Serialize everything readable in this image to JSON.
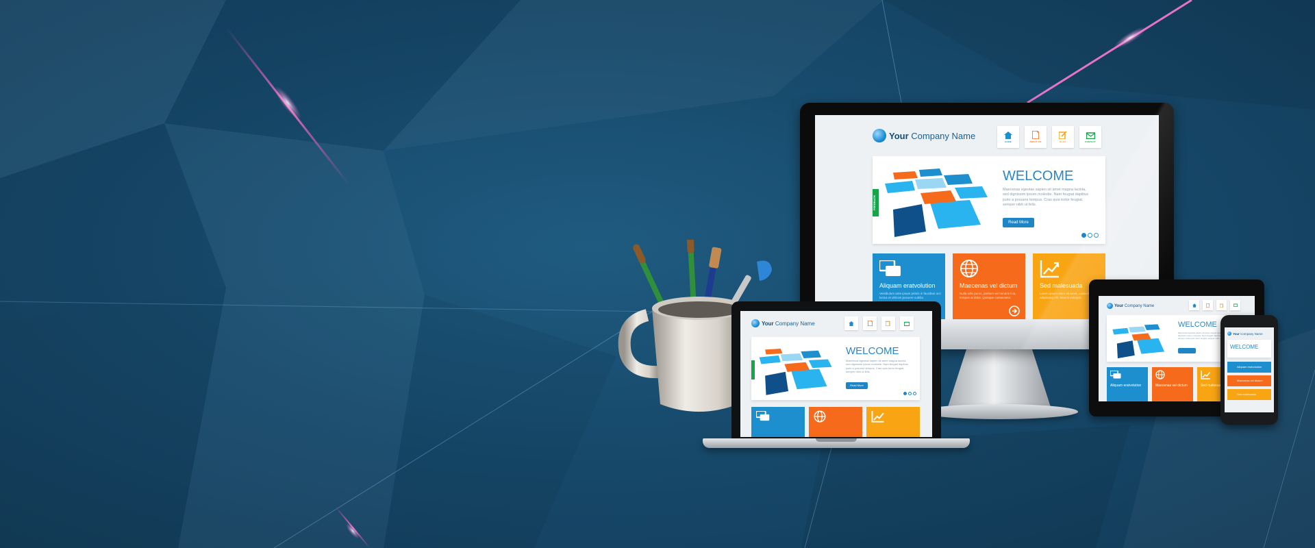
{
  "colors": {
    "background": "#174a6c",
    "accent_blue": "#1d8fcf",
    "accent_orange": "#f66b1b",
    "accent_amber": "#f9a413",
    "feedback_green": "#16a44a"
  },
  "mockup": {
    "company_bold": "Your",
    "company_rest": " Company Name",
    "nav": [
      {
        "label": "HOME",
        "icon": "home-icon",
        "color": "#1d8fcf"
      },
      {
        "label": "ABOUT US",
        "icon": "document-icon",
        "color": "#f66b1b"
      },
      {
        "label": "BLOG",
        "icon": "edit-icon",
        "color": "#f9a413"
      },
      {
        "label": "CONTACT",
        "icon": "mail-icon",
        "color": "#16a44a"
      }
    ],
    "hero_title": "WELCOME",
    "hero_text": "Maecenas egestas sapien sit amet magna lacinia, sed dignissim ipsum molestie. Nam feugiat dapibus justo a posuere tempus. Cras quis tortor feugiat, semper nibh ut felis.",
    "read_more": "Read More",
    "feedback": "FEEDBACK",
    "tiles": [
      {
        "title": "Aliquam eratvolution",
        "icon": "chat-bubbles-icon",
        "color": "blue",
        "text": "Vestibulum ante ipsum primis in faucibus orci luctus et ultrices posuere cubilia."
      },
      {
        "title": "Maecenas vel dictum",
        "icon": "globe-icon",
        "color": "orange",
        "text": "Nulla odio purus, pretium vel hendrerit at, tempus at dolor. Quisque consectetur."
      },
      {
        "title": "Sed malesuada",
        "icon": "chart-up-icon",
        "color": "amber",
        "text": "Lorem ipsum dolor sit amet, consectetur adipiscing elit. Mauris volutpat."
      }
    ],
    "slide_count": 3,
    "active_slide": 1
  }
}
